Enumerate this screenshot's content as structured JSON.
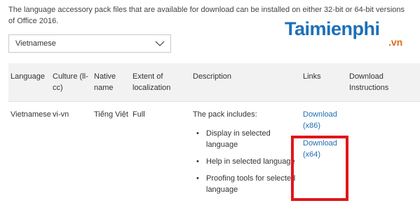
{
  "intro_text": "The language accessory pack files that are available for download can be installed on either 32-bit or 64-bit versions of Office 2016.",
  "watermark": {
    "main": "Taimienphi",
    "sub": ".vn"
  },
  "language_select": {
    "value": "Vietnamese",
    "icon": "chevron-down-icon"
  },
  "table": {
    "headers": {
      "language": "Language",
      "culture": "Culture (ll-cc)",
      "native_name": "Native name",
      "extent": "Extent of localization",
      "description": "Description",
      "links": "Links",
      "instructions": "Download Instructions"
    },
    "row": {
      "language": "Vietnamese",
      "culture": "vi-vn",
      "native_name": "Tiếng Việt",
      "extent": "Full",
      "description_intro": "The pack includes:",
      "bullets": [
        "Display in selected language",
        "Help in selected language",
        "Proofing tools for selected language"
      ],
      "links": [
        "Download (x86)",
        "Download (x64)"
      ]
    }
  },
  "colors": {
    "link": "#1f6fb5",
    "highlight": "#e0161b",
    "header_bg": "#f2f2f2"
  }
}
